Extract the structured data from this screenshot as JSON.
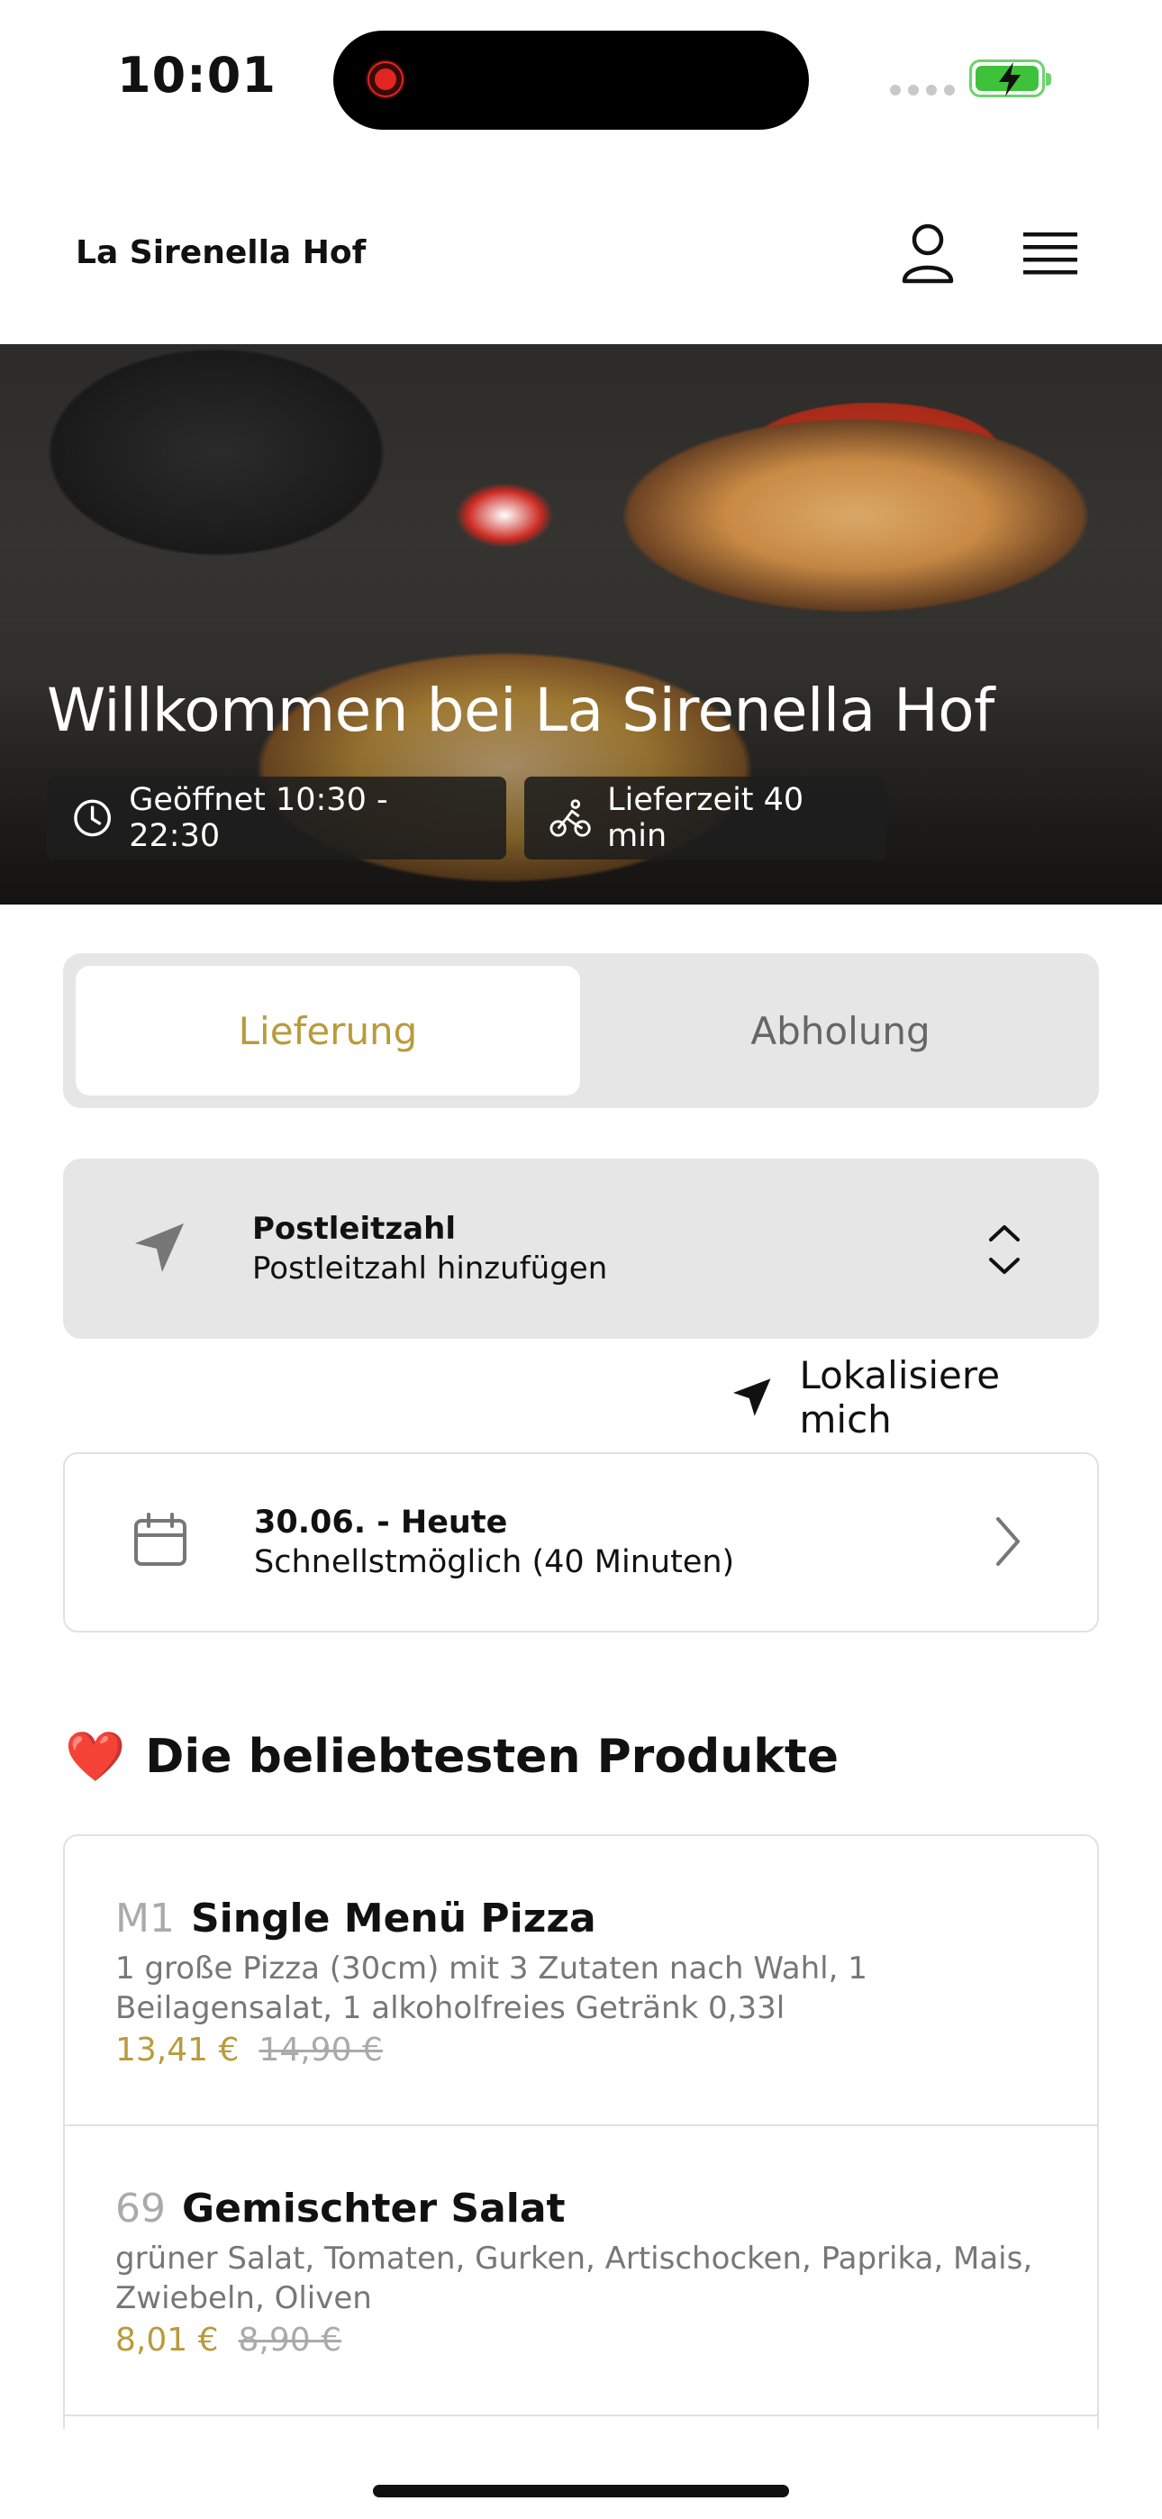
{
  "status_bar": {
    "time": "10:01"
  },
  "header": {
    "brand": "La Sirenella Hof"
  },
  "hero": {
    "title": "Willkommen bei La Sirenella Hof",
    "opening_hours": "Geöffnet 10:30 - 22:30",
    "delivery_time": "Lieferzeit 40 min"
  },
  "order_mode": {
    "options": [
      "Lieferung",
      "Abholung"
    ],
    "selected": "Lieferung"
  },
  "postal_code": {
    "label": "Postleitzahl",
    "placeholder": "Postleitzahl hinzufügen"
  },
  "locate": {
    "label": "Lokalisiere mich"
  },
  "schedule": {
    "date": "30.06. - Heute",
    "time": "Schnellstmöglich (40 Minuten)"
  },
  "popular": {
    "emoji": "❤️",
    "title": "Die beliebtesten Produkte",
    "items": [
      {
        "number": "M1",
        "name": "Single Menü Pizza",
        "description": "1 große Pizza (30cm) mit 3 Zutaten nach Wahl, 1 Beilagensalat, 1 alkoholfreies Getränk 0,33l",
        "price": "13,41 €",
        "old_price": "14,90 €"
      },
      {
        "number": "69",
        "name": "Gemischter Salat",
        "description": "grüner Salat, Tomaten, Gurken, Artischocken, Paprika, Mais, Zwiebeln, Oliven",
        "price": "8,01 €",
        "old_price": "8,90 €"
      }
    ]
  },
  "colors": {
    "accent": "#b99b3c",
    "card_bg": "#e6e6e6",
    "muted": "#777777"
  }
}
